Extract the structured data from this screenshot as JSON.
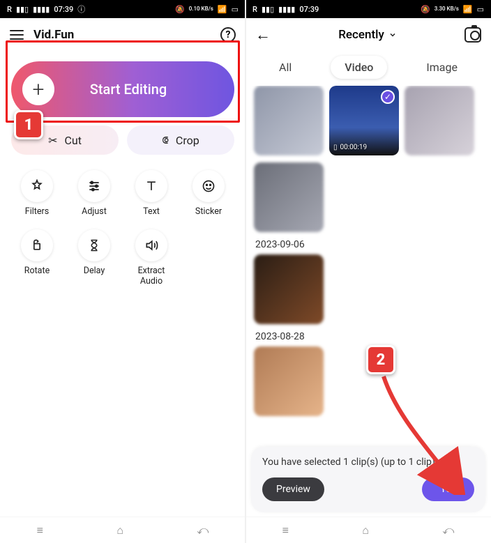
{
  "status": {
    "time": "07:39",
    "carrier": "R",
    "net": "0.10 KB/s",
    "net2": "3.30 KB/s"
  },
  "left": {
    "title": "Vid.Fun",
    "start_label": "Start Editing",
    "quick": {
      "cut": "Cut",
      "crop": "Crop"
    },
    "tools": {
      "filters": "Filters",
      "adjust": "Adjust",
      "text": "Text",
      "sticker": "Sticker",
      "rotate": "Rotate",
      "delay": "Delay",
      "extract_audio": "Extract\nAudio"
    }
  },
  "right": {
    "dropdown": "Recently",
    "tabs": {
      "all": "All",
      "video": "Video",
      "image": "Image"
    },
    "selected_duration": "00:00:19",
    "sections": {
      "d1": "2023-09-06",
      "d2": "2023-08-28"
    },
    "sheet": {
      "text": "You have selected 1 clip(s) (up to 1 clip)",
      "preview": "Preview",
      "yes": "Yes"
    }
  },
  "annotations": {
    "one": "1",
    "two": "2"
  }
}
